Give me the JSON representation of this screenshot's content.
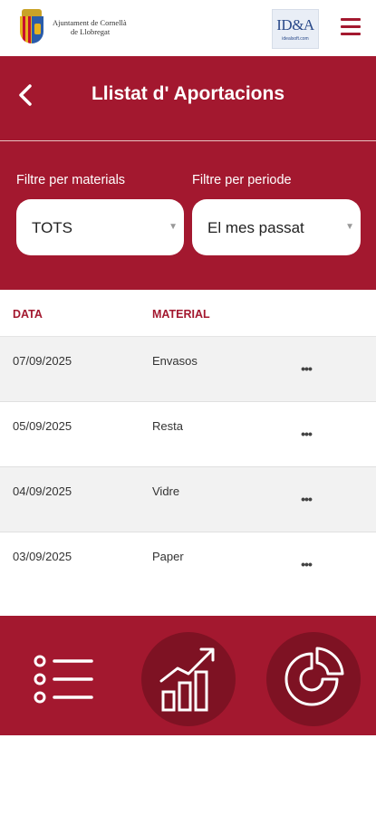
{
  "brand": {
    "org_line1": "Ajuntament de Cornellà",
    "org_line2": "de Llobregat",
    "partner_logo": "ID&A",
    "partner_sub": "idealsoft.com"
  },
  "header": {
    "title": "Llistat d' Aportacions"
  },
  "filters": {
    "material_label": "Filtre per materials",
    "material_value": "TOTS",
    "period_label": "Filtre per periode",
    "period_value": "El mes passat"
  },
  "table": {
    "columns": [
      "DATA",
      "MATERIAL"
    ],
    "rows": [
      {
        "date": "07/09/2025",
        "material": "Envasos"
      },
      {
        "date": "05/09/2025",
        "material": "Resta"
      },
      {
        "date": "04/09/2025",
        "material": "Vidre"
      },
      {
        "date": "03/09/2025",
        "material": "Paper"
      }
    ],
    "row_action_glyph": "•••"
  },
  "icons": {
    "back": "chevron-left-icon",
    "menu": "hamburger-icon",
    "nav_list": "list-icon",
    "nav_stats": "bar-chart-growth-icon",
    "nav_pie": "pie-chart-icon"
  },
  "colors": {
    "primary": "#a3182f",
    "primary_dark": "#7e1223",
    "row_alt": "#f2f2f2"
  }
}
